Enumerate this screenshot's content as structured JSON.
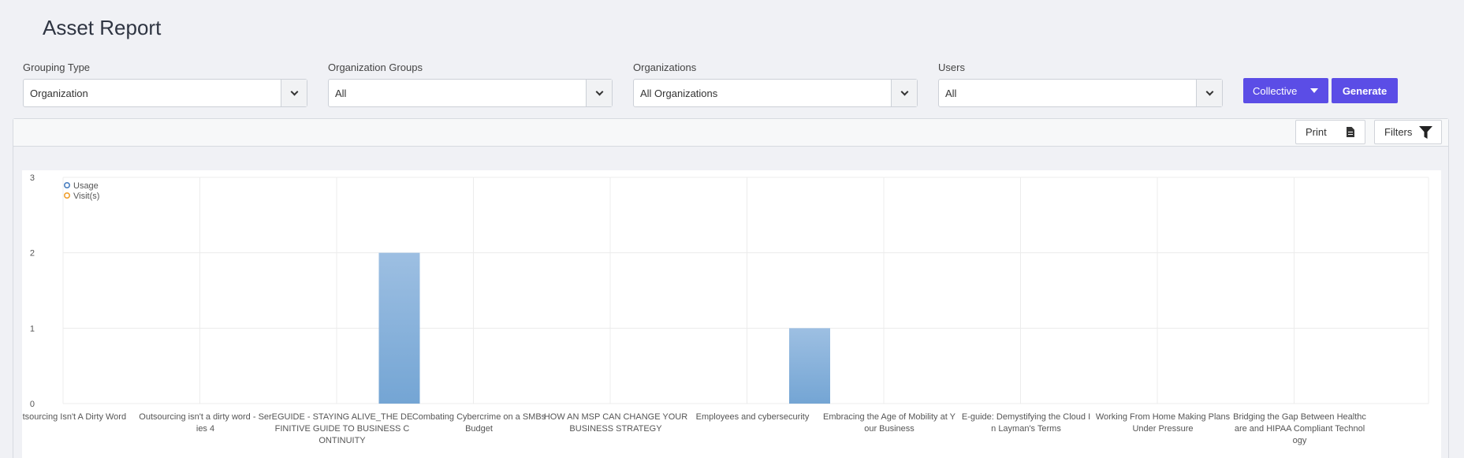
{
  "header": {
    "title": "Asset Report"
  },
  "filters": {
    "grouping_type": {
      "label": "Grouping Type",
      "value": "Organization"
    },
    "organization_groups": {
      "label": "Organization Groups",
      "value": "All"
    },
    "organizations": {
      "label": "Organizations",
      "value": "All Organizations"
    },
    "users": {
      "label": "Users",
      "value": "All"
    }
  },
  "actions": {
    "collective_label": "Collective",
    "generate_label": "Generate"
  },
  "toolbar": {
    "print_label": "Print",
    "filters_label": "Filters"
  },
  "colors": {
    "accent": "#5b4de6",
    "bar_top": "#9dbfe2",
    "bar_bottom": "#74a5d4",
    "usage_legend": "#4a7fc1",
    "visits_legend": "#f0a030"
  },
  "chart_data": {
    "type": "bar",
    "categories": [
      "Outsourcing Isn't A Dirty Word",
      "Outsourcing isn't a dirty word - Series 4",
      "EGUIDE - STAYING ALIVE_THE DEFINITIVE GUIDE TO BUSINESS CONTINUITY",
      "Combating Cybercrime on a SMBs Budget",
      "HOW AN MSP CAN CHANGE YOUR BUSINESS STRATEGY",
      "Employees and cybersecurity",
      "Embracing the Age of Mobility at Your Business",
      "E-guide: Demystifying the Cloud In Layman's Terms",
      "Working From Home Making Plans Under Pressure",
      "Bridging the Gap Between Healthcare and HIPAA Compliant Technology"
    ],
    "category_label_lines": [
      [
        "Outsourcing Isn't A Dirty Word"
      ],
      [
        "Outsourcing isn't a dirty word - Ser",
        "ies 4"
      ],
      [
        "EGUIDE - STAYING ALIVE_THE DE",
        "FINITIVE GUIDE TO BUSINESS C",
        "ONTINUITY"
      ],
      [
        "Combating Cybercrime on a SMBs",
        "Budget"
      ],
      [
        "HOW AN MSP CAN CHANGE YOUR",
        "BUSINESS STRATEGY"
      ],
      [
        "Employees and cybersecurity"
      ],
      [
        "Embracing the Age of Mobility at Y",
        "our Business"
      ],
      [
        "E-guide: Demystifying the Cloud I",
        "n Layman's Terms"
      ],
      [
        "Working From Home Making Plans",
        "Under Pressure"
      ],
      [
        "Bridging the Gap Between Healthc",
        "are and HIPAA Compliant Technol",
        "ogy"
      ]
    ],
    "series": [
      {
        "name": "Usage",
        "values": [
          0,
          0,
          2,
          0,
          0,
          1,
          0,
          0,
          0,
          0
        ]
      },
      {
        "name": "Visit(s)",
        "values": [
          0,
          0,
          0,
          0,
          0,
          0,
          0,
          0,
          0,
          0
        ]
      }
    ],
    "y_ticks": [
      "0",
      "1",
      "2",
      "3"
    ],
    "ylim": [
      0,
      3
    ],
    "grid": true,
    "legend_position": "top-left"
  }
}
